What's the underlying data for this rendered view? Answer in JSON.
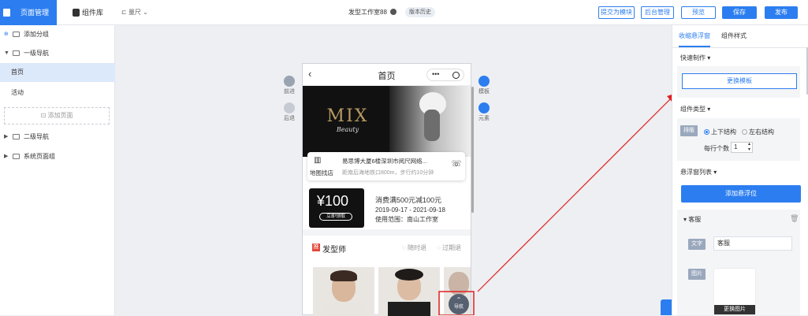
{
  "topbar": {
    "tab_pages": "页面管理",
    "tab_components": "组件库",
    "ruler": "量尺",
    "studio_title": "发型工作室88",
    "version_history": "版本历史",
    "btn_submit_module": "提交为模块",
    "btn_admin": "后台管理",
    "btn_preview": "预览",
    "btn_save": "保存",
    "btn_publish": "发布"
  },
  "left": {
    "add_group": "添加分组",
    "nav1": "一级导航",
    "page_home": "首页",
    "page_activity": "活动",
    "add_page": "添加页面",
    "nav2": "二级导航",
    "system_group": "系统页面组"
  },
  "side": {
    "forward": "前进",
    "back": "后退",
    "template": "模板",
    "element": "元素"
  },
  "phone": {
    "title": "首页",
    "banner_text": "MIX",
    "banner_sub": "Beauty",
    "address": "易思博大厦6楼深圳市阅尺网络...",
    "map_label": "地图找店",
    "distance": "距南后海地铁口800m，步行约10分钟",
    "coupon_value": "¥100",
    "coupon_btn": "立即领取",
    "coupon_title": "消费满500元减100元",
    "coupon_date": "2019-09-17 - 2021-09-18",
    "coupon_scope": "使用范围：南山工作室",
    "stylist_badge": "推",
    "stylist_title": "发型师",
    "opt_anytime": "随时退",
    "opt_expired": "过期退",
    "nav_float": "导航"
  },
  "right": {
    "tab_float": "收缩悬浮窗",
    "tab_style": "组件样式",
    "quick_make": "快速制作",
    "change_template": "更换模板",
    "comp_type": "组件类型",
    "layout_tag": "排版",
    "opt_vertical": "上下结构",
    "opt_horizontal": "左右结构",
    "per_row_label": "每行个数",
    "per_row_value": "1",
    "float_list": "悬浮窗列表",
    "add_float": "添加悬浮位",
    "item_name": "客服",
    "text_tag": "文字",
    "text_value": "客服",
    "image_tag": "图片",
    "change_image": "更换图片"
  },
  "colors": {
    "accent": "#2c7ef0",
    "annotation": "#e02020"
  }
}
